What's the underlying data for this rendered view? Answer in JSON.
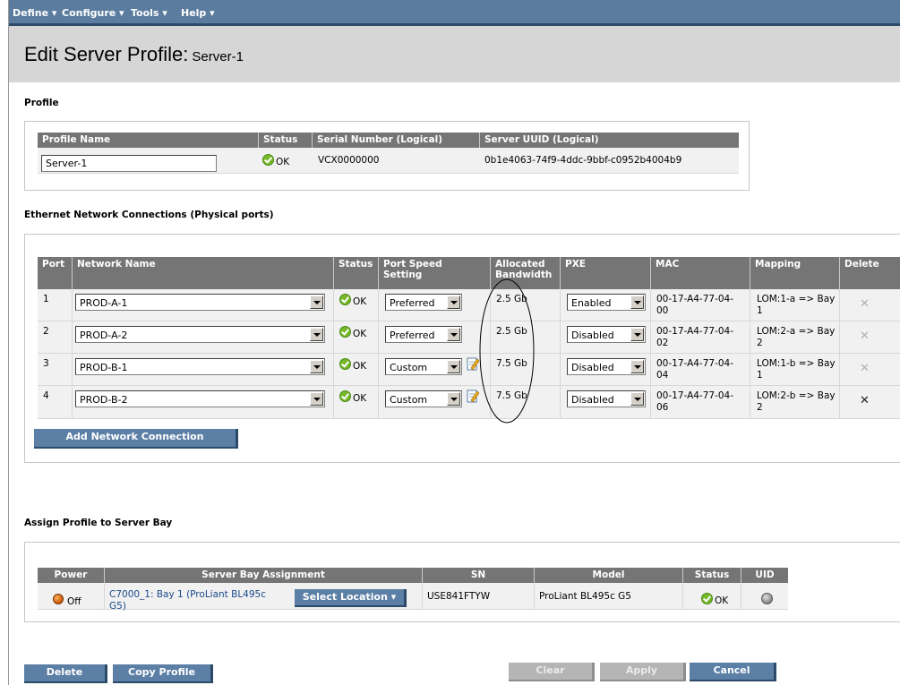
{
  "menu": [
    {
      "label": "Define ▾"
    },
    {
      "label": "Configure ▾"
    },
    {
      "label": "Tools ▾"
    },
    {
      "label": "Help ▾"
    }
  ],
  "page": {
    "title": "Edit Server Profile:",
    "subtitle": "Server-1"
  },
  "profile": {
    "heading": "Profile",
    "headers": {
      "name": "Profile Name",
      "status": "Status",
      "serial": "Serial Number (Logical)",
      "uuid": "Server UUID (Logical)"
    },
    "name_value": "Server-1",
    "status": "OK",
    "serial": "VCX0000000",
    "uuid": "0b1e4063-74f9-4ddc-9bbf-c0952b4004b9"
  },
  "ethernet": {
    "heading": "Ethernet Network Connections (Physical ports)",
    "headers": {
      "port": "Port",
      "network": "Network Name",
      "status": "Status",
      "speed1": "Port Speed",
      "speed2": "Setting",
      "bw1": "Allocated",
      "bw2": "Bandwidth",
      "pxe": "PXE",
      "mac": "MAC",
      "mapping": "Mapping",
      "delete": "Delete"
    },
    "rows": [
      {
        "port": "1",
        "network": "PROD-A-1",
        "status": "OK",
        "speed": "Preferred",
        "bandwidth": "2.5 Gb",
        "pxe": "Enabled",
        "mac1": "00-17-A4-77-04-",
        "mac2": "00",
        "map1": "LOM:1-a => Bay",
        "map2": "1"
      },
      {
        "port": "2",
        "network": "PROD-A-2",
        "status": "OK",
        "speed": "Preferred",
        "bandwidth": "2.5 Gb",
        "pxe": "Disabled",
        "mac1": "00-17-A4-77-04-",
        "mac2": "02",
        "map1": "LOM:2-a => Bay",
        "map2": "2"
      },
      {
        "port": "3",
        "network": "PROD-B-1",
        "status": "OK",
        "speed": "Custom",
        "bandwidth": "7.5 Gb",
        "pxe": "Disabled",
        "mac1": "00-17-A4-77-04-",
        "mac2": "04",
        "map1": "LOM:1-b => Bay",
        "map2": "1"
      },
      {
        "port": "4",
        "network": "PROD-B-2",
        "status": "OK",
        "speed": "Custom",
        "bandwidth": "7.5 Gb",
        "pxe": "Disabled",
        "mac1": "00-17-A4-77-04-",
        "mac2": "06",
        "map1": "LOM:2-b => Bay",
        "map2": "2"
      }
    ],
    "add_button": "Add Network Connection"
  },
  "assign": {
    "heading": "Assign Profile to Server Bay",
    "headers": {
      "power": "Power",
      "bay": "Server Bay Assignment",
      "sn": "SN",
      "model": "Model",
      "status": "Status",
      "uid": "UID"
    },
    "power": "Off",
    "bay_line1": "C7000_1: Bay 1 (ProLiant BL495c",
    "bay_line2": "G5)",
    "select_location": "Select Location ▾",
    "sn": "USE841FTYW",
    "model": "ProLiant BL495c G5",
    "status": "OK"
  },
  "buttons": {
    "delete": "Delete",
    "copy": "Copy Profile",
    "clear": "Clear",
    "apply": "Apply",
    "cancel": "Cancel"
  },
  "colors": {
    "menubar": "#5b7c9e",
    "header": "#757575",
    "button": "#5c7fa6",
    "ok": "#76b82a"
  }
}
